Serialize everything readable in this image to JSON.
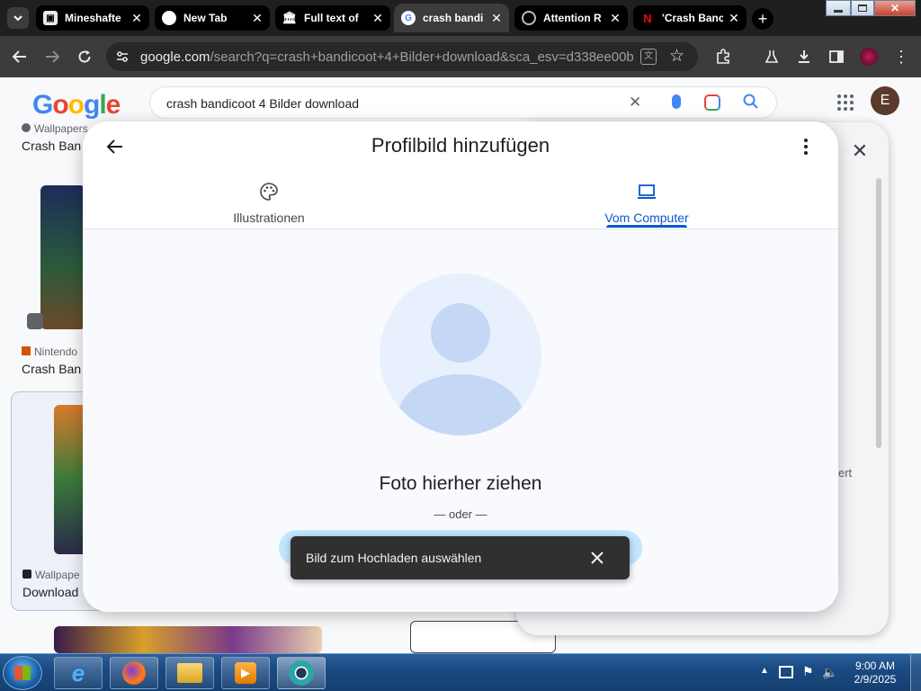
{
  "browser": {
    "tabs": [
      {
        "title": "Mineshafte",
        "favicon": "box-icon",
        "active": false
      },
      {
        "title": "New Tab",
        "favicon": "chat-bubble-icon",
        "active": false
      },
      {
        "title": "Full text of",
        "favicon": "archive-icon",
        "active": false
      },
      {
        "title": "crash bandi",
        "favicon": "google-icon",
        "active": true
      },
      {
        "title": "Attention R",
        "favicon": "globe-icon",
        "active": false
      },
      {
        "title": "'Crash Banc",
        "favicon": "netflix-icon",
        "active": false
      }
    ],
    "url_host": "google.com",
    "url_path": "/search?q=crash+bandicoot+4+Bilder+download&sca_esv=d338ee00b303..."
  },
  "google": {
    "logo": "Google",
    "search_query": "crash bandicoot 4 Bilder download",
    "account_initial": "E",
    "results": [
      {
        "source": "Wallpapers",
        "title": "Crash Ban"
      },
      {
        "source": "Nintendo",
        "title": "Crash Ban"
      },
      {
        "source": "Wallpape",
        "title": "Download"
      }
    ],
    "side_panel_fragment": "ert"
  },
  "dialog": {
    "title": "Profilbild hinzufügen",
    "tabs": [
      {
        "label": "Illustrationen",
        "icon": "palette-icon",
        "active": false
      },
      {
        "label": "Vom Computer",
        "icon": "laptop-icon",
        "active": true
      }
    ],
    "drop_text": "Foto hierher ziehen",
    "or_text": "— oder —",
    "colors": {
      "accent": "#0b57d0",
      "avatar_bg": "#e8f0fe",
      "avatar_fg": "#c4d7f5"
    }
  },
  "toast": {
    "text": "Bild zum Hochladen auswählen"
  },
  "taskbar": {
    "time": "9:00 AM",
    "date": "2/9/2025",
    "apps": [
      "internet-explorer-icon",
      "firefox-icon",
      "file-explorer-icon",
      "media-player-icon",
      "chrome-icon"
    ]
  }
}
